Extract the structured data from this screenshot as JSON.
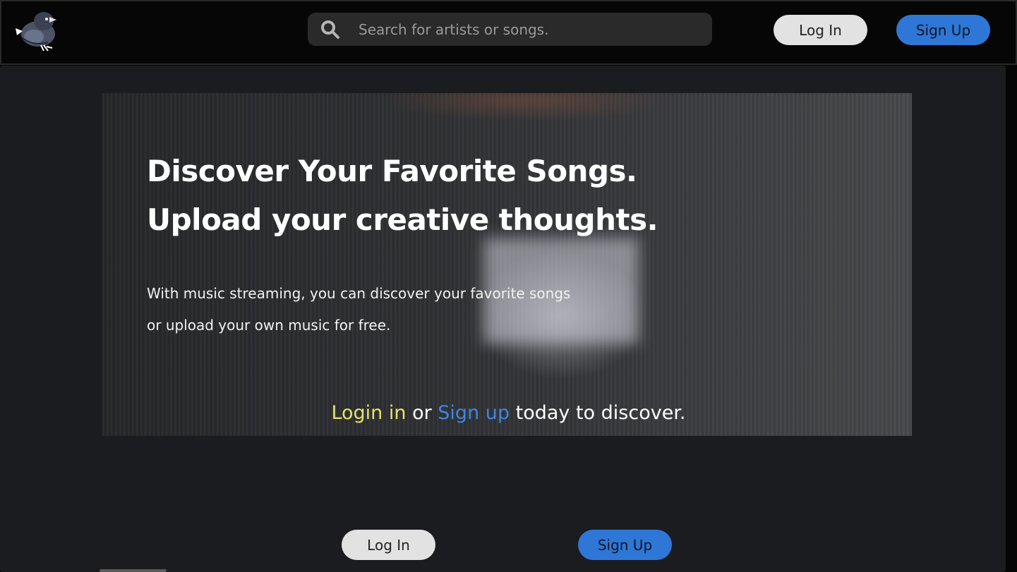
{
  "header": {
    "logo_name": "pigeon-logo",
    "search": {
      "placeholder": "Search for artists or songs."
    },
    "login_label": "Log In",
    "signup_label": "Sign Up"
  },
  "hero": {
    "title_line1": "Discover Your Favorite Songs.",
    "title_line2": "Upload your creative thoughts.",
    "text_line1": "With music streaming, you can discover your favorite songs",
    "text_line2": "or upload your own music for free."
  },
  "cta": {
    "login_link": "Login in",
    "or_text": " or ",
    "signup_link": "Sign up",
    "tail_text": " today to discover.",
    "login_label": "Log In",
    "signup_label": "Sign Up"
  },
  "colors": {
    "accent_blue": "#2f77d6",
    "accent_yellow": "#e3e36a",
    "background": "#1b1c1f",
    "header_bg": "#060606"
  }
}
